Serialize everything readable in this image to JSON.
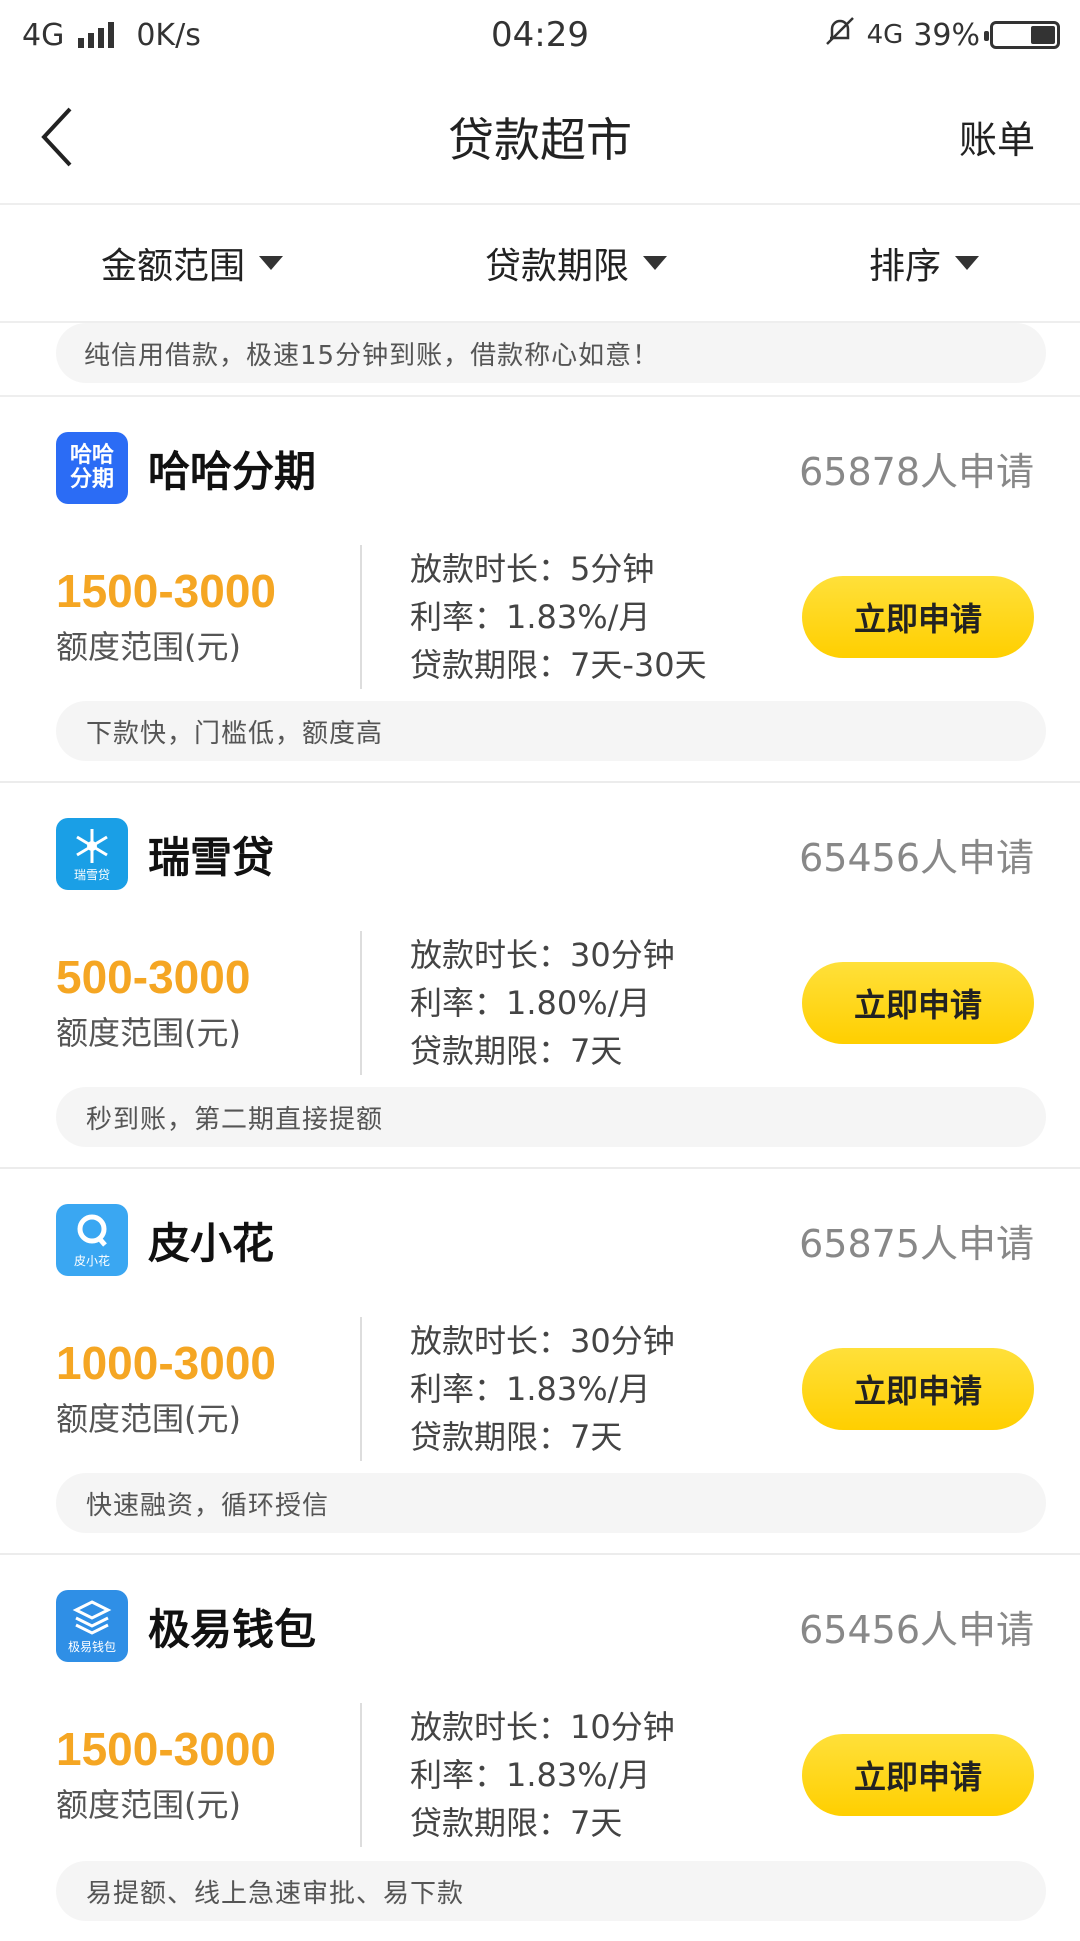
{
  "status_bar": {
    "network": "4G",
    "speed": "0K/s",
    "time": "04:29",
    "network_right": "4G",
    "battery": "39%"
  },
  "header": {
    "title": "贷款超市",
    "bill_label": "账单"
  },
  "filters": [
    {
      "label": "金额范围"
    },
    {
      "label": "贷款期限"
    },
    {
      "label": "排序"
    }
  ],
  "notice": "纯信用借款，极速15分钟到账，借款称心如意！",
  "products": [
    {
      "name": "哈哈分期",
      "logo_text": "哈哈分期",
      "logo_color": "#2b6cf5",
      "applicants": "65878人申请",
      "amount": "1500-3000",
      "amount_label": "额度范围(元)",
      "payout": "放款时长：5分钟",
      "rate": "利率：1.83%/月",
      "term": "贷款期限：7天-30天",
      "button": "立即申请",
      "desc": "下款快，门槛低，额度高"
    },
    {
      "name": "瑞雪贷",
      "logo_text": "瑞雪贷",
      "logo_color": "#1a9fe6",
      "applicants": "65456人申请",
      "amount": "500-3000",
      "amount_label": "额度范围(元)",
      "payout": "放款时长：30分钟",
      "rate": "利率：1.80%/月",
      "term": "贷款期限：7天",
      "button": "立即申请",
      "desc": "秒到账，第二期直接提额"
    },
    {
      "name": "皮小花",
      "logo_text": "皮小花",
      "logo_color": "#3aa7f2",
      "applicants": "65875人申请",
      "amount": "1000-3000",
      "amount_label": "额度范围(元)",
      "payout": "放款时长：30分钟",
      "rate": "利率：1.83%/月",
      "term": "贷款期限：7天",
      "button": "立即申请",
      "desc": "快速融资，循环授信"
    },
    {
      "name": "极易钱包",
      "logo_text": "极易钱包",
      "logo_color": "#2f8fe6",
      "applicants": "65456人申请",
      "amount": "1500-3000",
      "amount_label": "额度范围(元)",
      "payout": "放款时长：10分钟",
      "rate": "利率：1.83%/月",
      "term": "贷款期限：7天",
      "button": "立即申请",
      "desc": "易提额、线上急速审批、易下款"
    }
  ]
}
